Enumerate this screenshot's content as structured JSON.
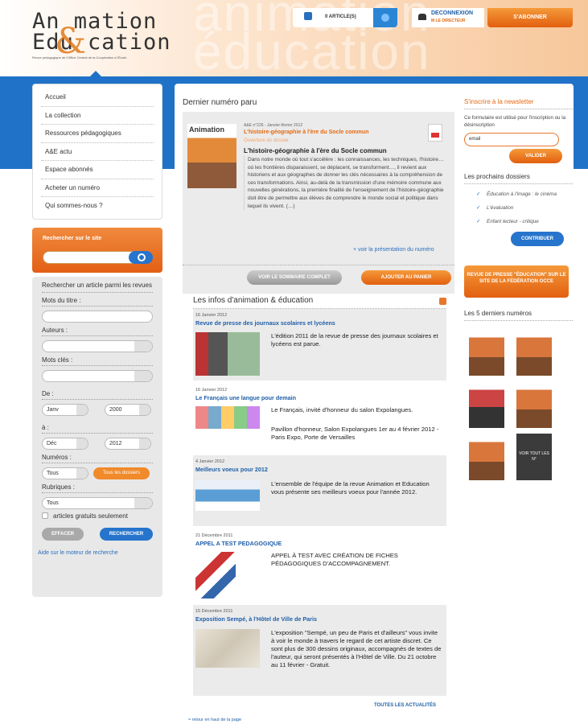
{
  "header": {
    "logo_line1": "An mation",
    "logo_line2": "Edu cation",
    "logo_amp": "&",
    "logo_sub": "Revue pédagogique de l'Office Central de la Coopération à l'École",
    "bg_text": "animation éducation",
    "cart": "0 ARTICLE(S)",
    "logout": "DECONNEXION",
    "logout_sub": "M LE DIRECTEUR",
    "subscribe": "S'ABONNER"
  },
  "menu": [
    "Accueil",
    "La collection",
    "Ressources pédagogiques",
    "A&E actu",
    "Espace abonnés",
    "Acheter un numéro",
    "Qui sommes-nous ?"
  ],
  "search": {
    "title": "Rechercher sur le site"
  },
  "advanced": {
    "heading": "Rechercher un article parmi les revues",
    "title_label": "Mots du titre :",
    "authors_label": "Auteurs :",
    "keywords_label": "Mots clés :",
    "from_label": "De :",
    "from_month": "Janv",
    "from_year": "2000",
    "to_label": "à :",
    "to_month": "Déc",
    "to_year": "2012",
    "numbers_label": "Numéros :",
    "numbers_value": "Tous",
    "all_files": "Tous les dossiers",
    "sections_label": "Rubriques :",
    "sections_value": "Tous",
    "free_only": "articles gratuits seulement",
    "clear": "EFFACER",
    "submit": "RECHERCHER",
    "help": "Aide sur le moteur de recherche"
  },
  "latest": {
    "heading": "Dernier numéro paru",
    "meta": "A&E n°226 - Janvier-février 2012",
    "title": "L'histoire-géographie à l'ère du Socle commun",
    "subtitle": "Ouverture du dossier",
    "headline": "L'histoire-géographie à l'ère du Socle commun",
    "body": "Dans notre monde où tout s'accélère : les connaissances, les techniques, l'histoire… où les frontières disparaissent, se déplacent, se transforment…, il revient aux historiens et aux géographes de donner les clés nécessaires à la compréhension de ces transformations. Ainsi, au-delà de la transmission d'une mémoire commune aux nouvelles générations, la première finalité de l'enseignement de l'histoire-géographie doit être de permettre aux élèves de comprendre le monde social et politique dans lequel ils vivent. (…)",
    "more": "+ voir la présentation du numéro",
    "btn_summary": "VOIR LE SOMMAIRE COMPLET",
    "btn_cart": "AJOUTER AU PANIER",
    "cover_text": "Animation"
  },
  "infos": {
    "heading": "Les infos d'animation & éducation",
    "items": [
      {
        "date": "16 Janvier 2012",
        "title": "Revue de presse des journaux scolaires et lycéens",
        "text": "L'édition 2011 de la revue de presse des journaux scolaires et lycéens est parue."
      },
      {
        "date": "16 Janvier 2012",
        "title": "Le Français une langue pour demain",
        "text": "Le Français, invité d'honneur du salon Expolangues.",
        "text2": "Pavillon d'honneur, Salon Expolangues 1er au 4 février 2012 - Paris Expo, Porte de Versailles"
      },
      {
        "date": "4 Janvier 2012",
        "title": "Meilleurs voeux pour 2012",
        "text": "L'ensemble de l'équipe de la revue Animation et Education vous présente ses meilleurs voeux pour l'année 2012."
      },
      {
        "date": "21 Décembre 2011",
        "title": "APPEL A TEST PEDAGOGIQUE",
        "text": "APPEL À TEST AVEC CRÉATION DE FICHES PÉDAGOGIQUES D'ACCOMPAGNEMENT."
      },
      {
        "date": "15 Décembre 2011",
        "title": "Exposition Sempé, à l'Hôtel de Ville de Paris",
        "text": "L'exposition \"Sempé, un peu de Paris et d'ailleurs\" vous invite à voir le monde à travers le regard de cet artiste discret. Ce sont plus de 300 dessins originaux, accompagnés de textes de l'auteur, qui seront présentés à l'Hôtel de Ville. Du 21 octobre au 11 février - Gratuit."
      }
    ],
    "all": "TOUTES LES ACTUALITÉS",
    "back": "≈ retour en haut de la page"
  },
  "right": {
    "newsletter": "S'inscrire à la newsletter",
    "nl_text": "Ce formulaire est utilisé pour l'inscription ou la désinscription",
    "email": "email",
    "validate": "VALIDER",
    "next_heading": "Les prochains dossiers",
    "next": [
      "Éducation à l'image : le cinéma",
      "L'évaluation",
      "Enfant lecteur - critique"
    ],
    "contribute": "CONTRIBUER",
    "press": "REVUE DE PRESSE \"ÉDUCATION\" SUR LE SITE DE LA FÉDÉRATION OCCE",
    "last_heading": "Les 5 derniers numéros",
    "see_all": "VOIR TOUT LES N°"
  }
}
